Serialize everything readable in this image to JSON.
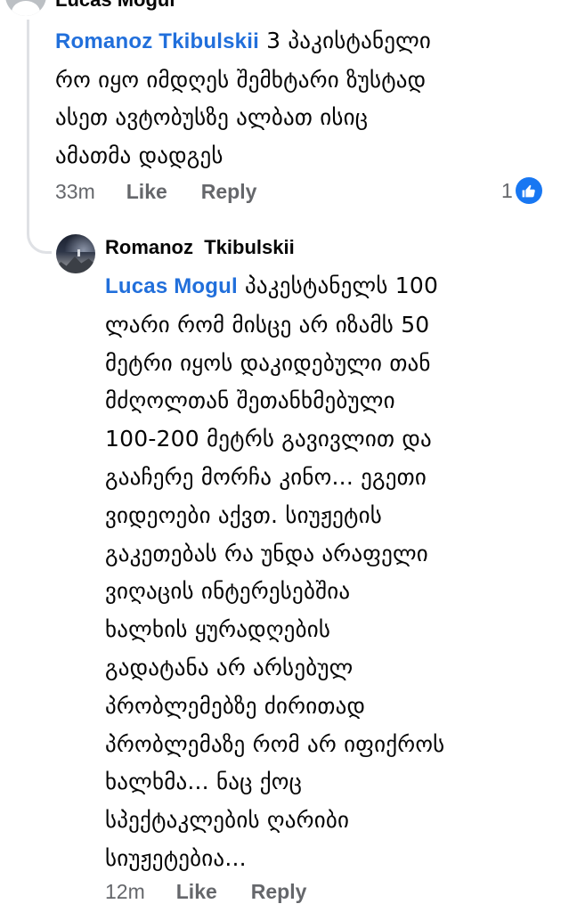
{
  "comment_top": {
    "author": "Lucas Mogul",
    "mention": "Romanoz  Tkibulskii",
    "lines": [
      " 3 პაკისტანელი",
      "რო იყო იმდღეს შემხტარი ზუსტად",
      "ასეთ ავტობუსზე ალბათ ისიც",
      "ამათმა დადგეს"
    ],
    "time": "33m",
    "like_label": "Like",
    "reply_label": "Reply",
    "reaction_count": "1",
    "reaction_icon": "thumbs-up-icon",
    "reaction_color": "#1877f2"
  },
  "comment_reply": {
    "author": "Romanoz  Tkibulskii",
    "mention": "Lucas Mogul",
    "lines": [
      " პაკესტანელს 100",
      "ლარი რომ მისცე არ იზამს 50",
      "მეტრი იყოს დაკიდებული თან",
      "მძღოლთან შეთანხმებული",
      "100-200 მეტრს გავივლით და",
      "გააჩერე მორჩა კინო... ეგეთი",
      "ვიდეოები აქვთ. სიუჟეტის",
      "გაკეთებას რა უნდა არაფელი",
      "ვიღაცის ინტერესებშია",
      "ხალხის ყურადღების",
      "გადატანა არ არსებულ",
      "პრობლემებზე ძირითად",
      "პრობლემაზე რომ არ იფიქროს",
      "ხალხმა... ნაც ქოც",
      "სპექტაკლების ღარიბი",
      "სიუჟეტებია..."
    ],
    "time": "12m",
    "like_label": "Like",
    "reply_label": "Reply"
  },
  "colors": {
    "mention": "#216fdb",
    "meta_text": "#65676b",
    "thread_line": "#dfe1e5"
  }
}
